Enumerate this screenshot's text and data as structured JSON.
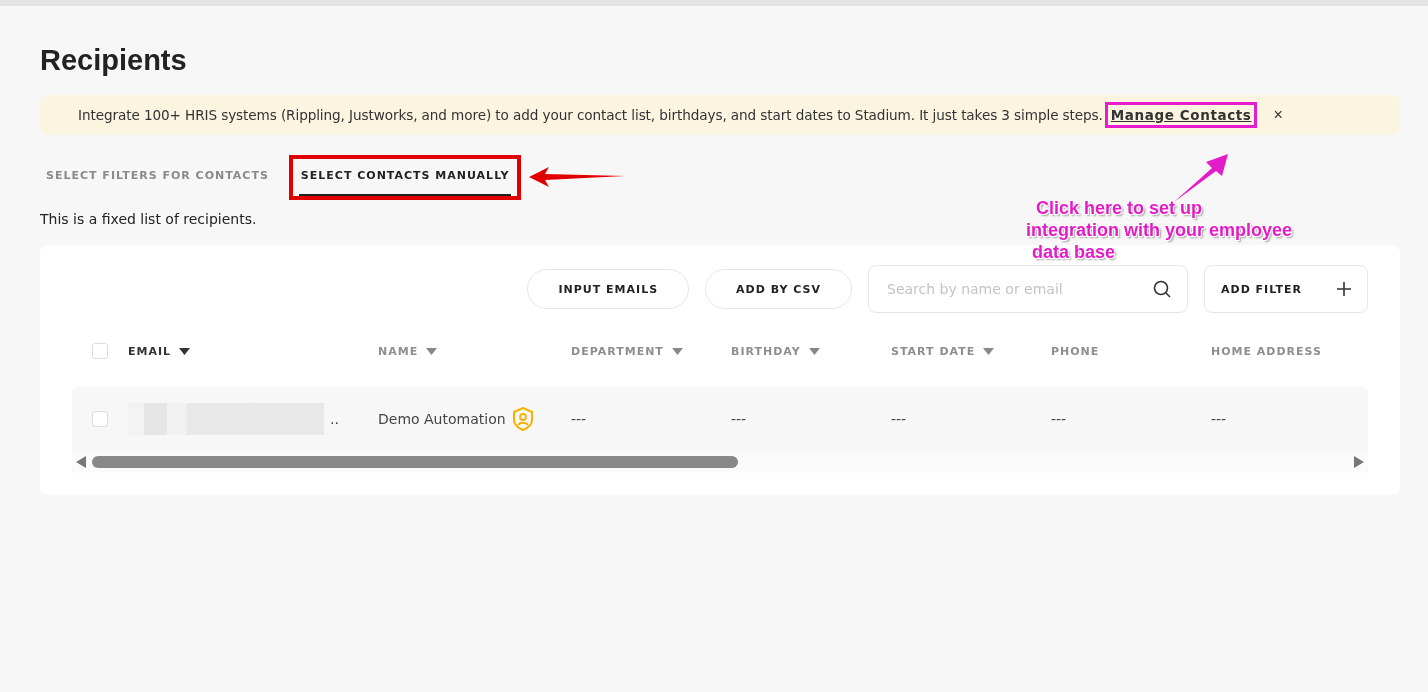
{
  "page": {
    "title": "Recipients"
  },
  "banner": {
    "text": "Integrate 100+ HRIS systems (Rippling, Justworks, and more) to add your contact list, birthdays, and start dates to Stadium. It just takes 3 simple steps.",
    "link": "Manage Contacts",
    "close": "×"
  },
  "tabs": [
    {
      "label": "SELECT FILTERS FOR CONTACTS",
      "selected": false
    },
    {
      "label": "SELECT CONTACTS MANUALLY",
      "selected": true
    }
  ],
  "description": "This is a fixed list of recipients.",
  "toolbar": {
    "buttons": [
      "INPUT EMAILS",
      "ADD BY CSV"
    ],
    "search": {
      "placeholder": "Search by name or email"
    },
    "filter_button": "ADD FILTER"
  },
  "table": {
    "select_all_checked": false,
    "columns": [
      {
        "label": "EMAIL",
        "sortable": true,
        "active": true
      },
      {
        "label": "NAME",
        "sortable": true,
        "active": false
      },
      {
        "label": "DEPARTMENT",
        "sortable": true,
        "active": false
      },
      {
        "label": "BIRTHDAY",
        "sortable": true,
        "active": false
      },
      {
        "label": "START DATE",
        "sortable": true,
        "active": false
      },
      {
        "label": "PHONE",
        "sortable": false,
        "active": false
      },
      {
        "label": "HOME ADDRESS",
        "sortable": false,
        "active": false
      }
    ],
    "rows": [
      {
        "checked": false,
        "email_redacted": true,
        "admin_badge": true,
        "cells": [
          "..",
          "Demo Automation",
          "---",
          "---",
          "---",
          "---",
          "---"
        ]
      }
    ]
  },
  "annotations": {
    "tab_highlight": true,
    "link_highlight": true,
    "note": [
      "Click here to set up",
      "integration with your employee",
      "data base"
    ]
  }
}
